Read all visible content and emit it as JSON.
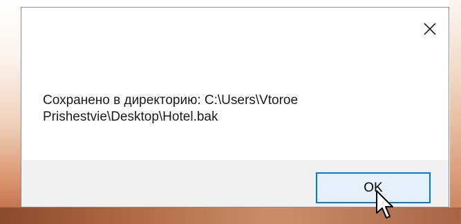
{
  "dialog": {
    "message": "Сохранено в директорию: C:\\Users\\Vtoroe\nPrishestvie\\Desktop\\Hotel.bak",
    "ok_label": "OK",
    "close_icon": "close-icon"
  },
  "cursor": {
    "icon": "mouse-pointer-icon"
  },
  "colors": {
    "accent": "#0078d7",
    "button_fill": "#e5f1fb",
    "footer": "#f0f0f0"
  }
}
